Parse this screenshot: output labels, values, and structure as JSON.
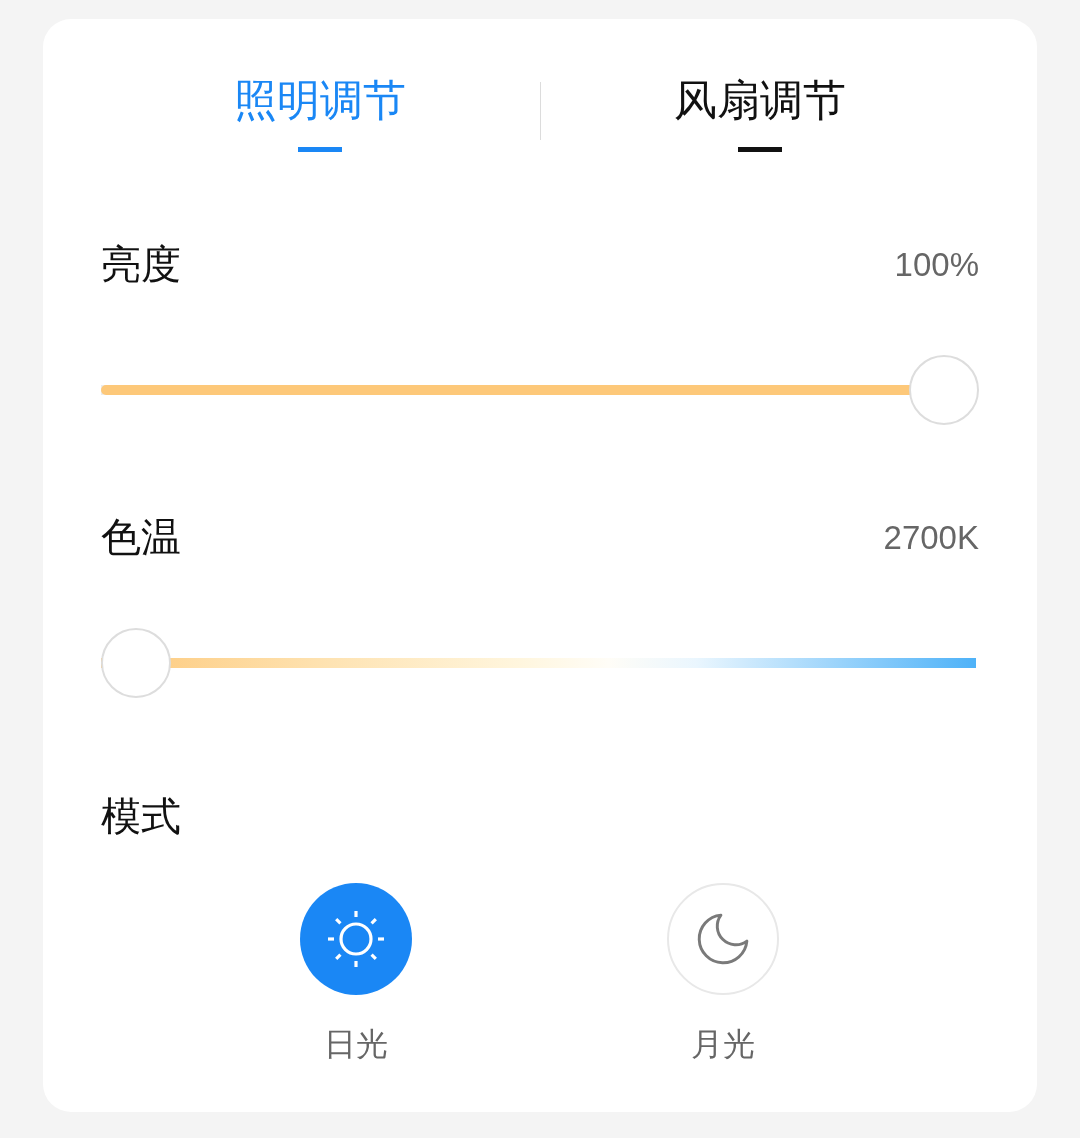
{
  "tabs": [
    {
      "label": "照明调节",
      "selected": true
    },
    {
      "label": "风扇调节",
      "selected": false
    }
  ],
  "sliders": [
    {
      "kind": "fill",
      "label": "亮度",
      "reading": "100%",
      "level": 1
    },
    {
      "kind": "gradient",
      "label": "色温",
      "reading": "2700K",
      "level": 0
    }
  ],
  "mode": {
    "label": "模式",
    "options": [
      {
        "label": "日光",
        "selected": true
      },
      {
        "label": "月光",
        "selected": false
      }
    ]
  }
}
